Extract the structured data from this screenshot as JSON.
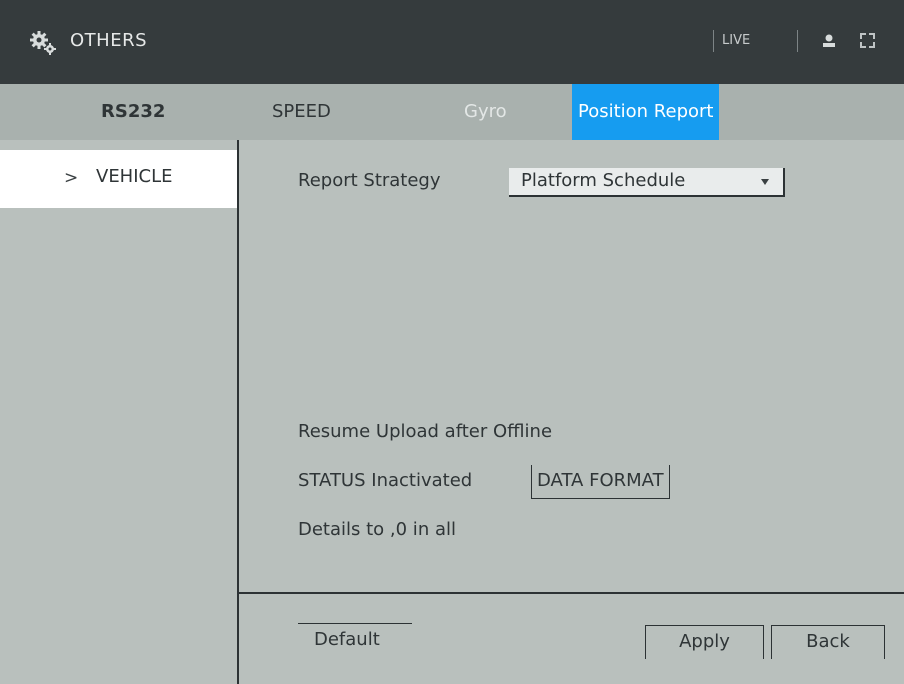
{
  "header": {
    "title": "OTHERS",
    "live_label": "LIVE",
    "icons": {
      "settings": "gear-icon",
      "user": "user-icon",
      "grid": "grid-icon"
    }
  },
  "tabs": [
    {
      "label": "RS232",
      "state": "bold"
    },
    {
      "label": "SPEED",
      "state": "normal"
    },
    {
      "label": "Gyro",
      "state": "dim"
    },
    {
      "label": "Position Report",
      "state": "active"
    }
  ],
  "sidebar": {
    "items": [
      {
        "label": "VEHICLE",
        "chevron": ">",
        "selected": true
      }
    ]
  },
  "form": {
    "report_strategy_label": "Report Strategy",
    "report_strategy_value": "Platform Schedule",
    "resume_upload_label": "Resume Upload after Offline",
    "status_text": "STATUS Inactivated",
    "data_format_label": "DATA FORMAT",
    "details_text": "Details to ,0 in all"
  },
  "footer": {
    "default_label": "Default",
    "apply_label": "Apply",
    "back_label": "Back"
  },
  "colors": {
    "header_bg": "#353b3d",
    "tabbar_bg": "#a9b1ae",
    "content_bg": "#b9c0bd",
    "active_tab": "#169cf0"
  }
}
